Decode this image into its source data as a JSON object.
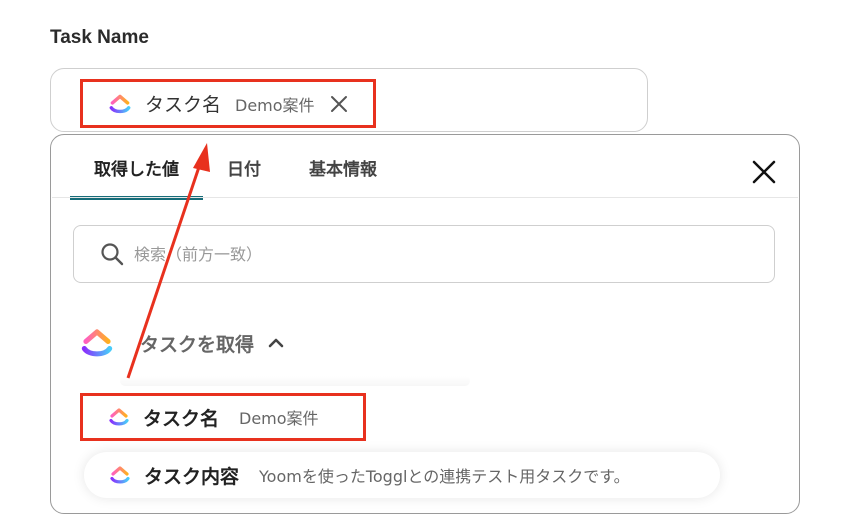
{
  "field": {
    "label": "Task Name"
  },
  "selected_chip": {
    "name": "タスク名",
    "value": "Demo案件",
    "close_icon": "close-icon"
  },
  "tabs": [
    {
      "label": "取得した値",
      "active": true
    },
    {
      "label": "日付",
      "active": false
    },
    {
      "label": "基本情報",
      "active": false
    }
  ],
  "search": {
    "placeholder": "検索（前方一致）",
    "value": ""
  },
  "group": {
    "title": "タスクを取得",
    "icon": "clickup-logo-icon",
    "expanded": true
  },
  "items": [
    {
      "name": "タスク名",
      "value": "Demo案件"
    },
    {
      "name": "タスク内容",
      "value": "Yoomを使ったTogglとの連携テスト用タスクです。"
    }
  ],
  "colors": {
    "highlight": "#e8311e",
    "tab_underline": "#176c79"
  }
}
